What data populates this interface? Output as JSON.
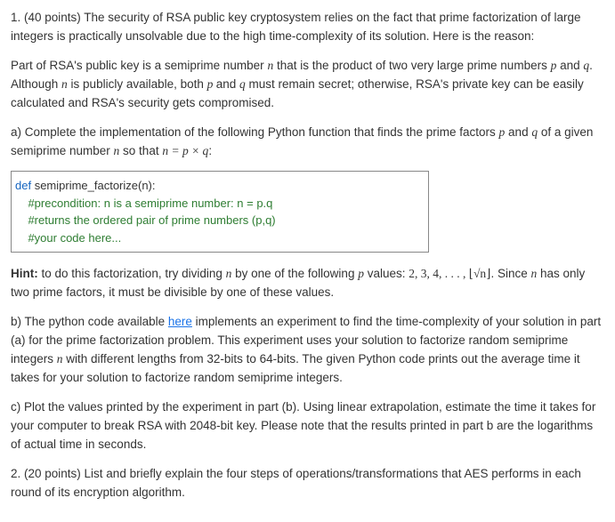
{
  "q1": {
    "intro1": "1. (40 points) The security of RSA public key cryptosystem relies on the fact that prime factorization of large integers is practically unsolvable due to the high time-complexity of its solution. Here is the reason:",
    "intro2_a": "Part of RSA's public key is a semiprime number ",
    "intro2_b": " that is the product of two very large prime numbers ",
    "intro2_c": " and ",
    "intro2_d": ". Although ",
    "intro2_e": " is publicly available, both ",
    "intro2_f": "and ",
    "intro2_g": " must remain secret; otherwise, RSA's private key can be easily calculated and RSA's security gets compromised.",
    "a_1": "a) Complete the implementation of the following Python function that finds the prime factors ",
    "a_2": " and ",
    "a_3": " of a given semiprime number ",
    "a_4": " so that ",
    "a_eq": "n = p × q",
    "a_5": ":",
    "code": {
      "l1_def": "def ",
      "l1_name": "semiprime_factorize(n):",
      "l2": "    #precondition: n is a semiprime number: n = p.q",
      "l3": "    #returns the ordered pair of prime numbers (p,q)",
      "l4": "    #your code here..."
    },
    "hint_label": "Hint:",
    "hint_1": " to do this factorization, try dividing ",
    "hint_2": " by one of the following ",
    "hint_3": " values: ",
    "hint_seq": "2, 3, 4, . . . , ⌊√n⌋",
    "hint_4": ". Since ",
    "hint_5": " has only two prime factors, it must be divisible by one of these values.",
    "b_1": "b) The python code available ",
    "b_link": "here",
    "b_2": " implements an experiment to find the time-complexity of your solution in part (a) for the prime factorization problem. This experiment uses your solution to factorize random semiprime integers ",
    "b_3": " with different lengths from 32-bits to 64-bits. The given Python code prints out the average time it takes for your solution to factorize random semiprime integers.",
    "c": "c) Plot the values printed by the experiment in part (b). Using linear extrapolation, estimate the time it takes for your computer to break RSA with 2048-bit key. Please note that the results printed in part b are the logarithms of actual time in seconds."
  },
  "q2": {
    "text": "2. (20 points) List and briefly explain the four steps of operations/transformations that AES performs in each round of its encryption algorithm."
  },
  "vars": {
    "n": "n",
    "p": "p",
    "q": "q",
    "p_": "p "
  }
}
